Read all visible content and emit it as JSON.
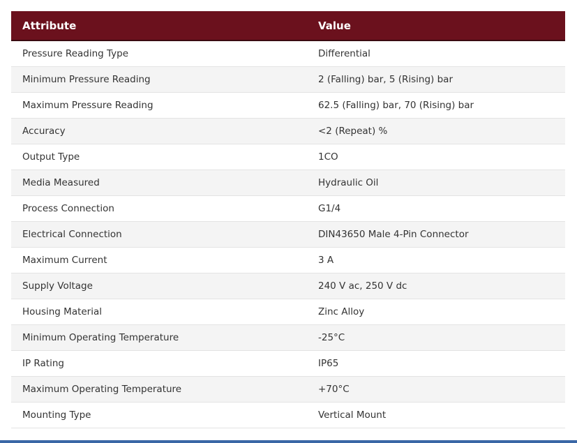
{
  "table": {
    "headers": {
      "attribute": "Attribute",
      "value": "Value"
    },
    "rows": [
      {
        "attribute": "Pressure Reading Type",
        "value": "Differential"
      },
      {
        "attribute": "Minimum Pressure Reading",
        "value": "2 (Falling) bar, 5 (Rising) bar"
      },
      {
        "attribute": "Maximum Pressure Reading",
        "value": "62.5 (Falling) bar, 70 (Rising) bar"
      },
      {
        "attribute": "Accuracy",
        "value": "<2 (Repeat) %"
      },
      {
        "attribute": "Output Type",
        "value": "1CO"
      },
      {
        "attribute": "Media Measured",
        "value": "Hydraulic Oil"
      },
      {
        "attribute": "Process Connection",
        "value": "G1/4"
      },
      {
        "attribute": "Electrical Connection",
        "value": "DIN43650 Male 4-Pin Connector"
      },
      {
        "attribute": "Maximum Current",
        "value": "3 A"
      },
      {
        "attribute": "Supply Voltage",
        "value": "240 V ac, 250 V dc"
      },
      {
        "attribute": "Housing Material",
        "value": "Zinc Alloy"
      },
      {
        "attribute": "Minimum Operating Temperature",
        "value": "-25°C"
      },
      {
        "attribute": "IP Rating",
        "value": "IP65"
      },
      {
        "attribute": "Maximum Operating Temperature",
        "value": "+70°C"
      },
      {
        "attribute": "Mounting Type",
        "value": "Vertical Mount"
      }
    ]
  },
  "colors": {
    "header_bg": "#6b111d",
    "header_text": "#ffffff",
    "row_alt_bg": "#f4f4f4",
    "bottom_bar": "#3a67a6"
  }
}
